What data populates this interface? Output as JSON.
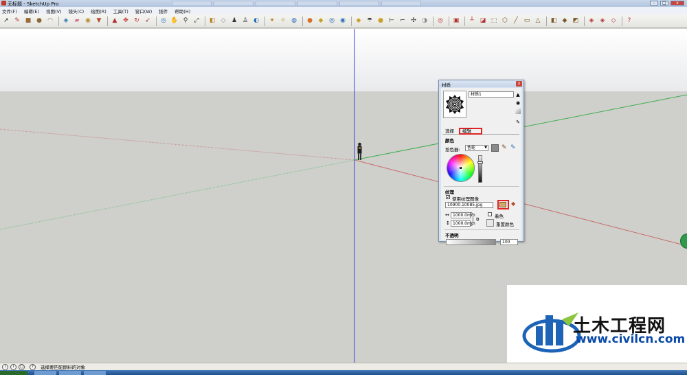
{
  "window": {
    "title": "无标题 - SketchUp Pro"
  },
  "menu": [
    "文件(F)",
    "编辑(E)",
    "视图(V)",
    "镜头(C)",
    "绘图(R)",
    "工具(T)",
    "窗口(W)",
    "插件",
    "帮助(H)"
  ],
  "toolbar_icons": [
    {
      "name": "select-icon",
      "glyph": "➚",
      "color": "#222"
    },
    {
      "name": "pencil-icon",
      "glyph": "✎",
      "color": "#b03030"
    },
    {
      "name": "rectangle-icon",
      "glyph": "■",
      "color": "#9b6b3c"
    },
    {
      "name": "circle-icon",
      "glyph": "●",
      "color": "#8a6a3a"
    },
    {
      "name": "arc-icon",
      "glyph": "◠",
      "color": "#8a6a3a"
    },
    {
      "name": "sep",
      "glyph": ""
    },
    {
      "name": "make-component-icon",
      "glyph": "◈",
      "color": "#2a6fb5"
    },
    {
      "name": "eraser-icon",
      "glyph": "▰",
      "color": "#d8708a"
    },
    {
      "name": "tape-measure-icon",
      "glyph": "◉",
      "color": "#b88a2a"
    },
    {
      "name": "paint-bucket-icon",
      "glyph": "▼",
      "color": "#b0502a"
    },
    {
      "name": "sep",
      "glyph": ""
    },
    {
      "name": "push-pull-icon",
      "glyph": "▲",
      "color": "#b03030"
    },
    {
      "name": "move-icon",
      "glyph": "✥",
      "color": "#c03030"
    },
    {
      "name": "rotate-icon",
      "glyph": "↻",
      "color": "#c03030"
    },
    {
      "name": "follow-me-icon",
      "glyph": "➶",
      "color": "#b03030"
    },
    {
      "name": "sep",
      "glyph": ""
    },
    {
      "name": "orbit-icon",
      "glyph": "◎",
      "color": "#2a6fb5"
    },
    {
      "name": "pan-icon",
      "glyph": "✋",
      "color": "#444"
    },
    {
      "name": "zoom-icon",
      "glyph": "⚲",
      "color": "#333"
    },
    {
      "name": "zoom-extents-icon",
      "glyph": "⤢",
      "color": "#333"
    },
    {
      "name": "sep",
      "glyph": ""
    },
    {
      "name": "previous-view-icon",
      "glyph": "◧",
      "color": "#b8872a"
    },
    {
      "name": "iso-view-icon",
      "glyph": "◇",
      "color": "#888"
    },
    {
      "name": "position-camera-icon",
      "glyph": "♟",
      "color": "#333"
    },
    {
      "name": "walk-icon",
      "glyph": "♙",
      "color": "#333"
    },
    {
      "name": "look-around-icon",
      "glyph": "◐",
      "color": "#2a6fb5"
    },
    {
      "name": "sep",
      "glyph": ""
    },
    {
      "name": "get-models-icon",
      "glyph": "✦",
      "color": "#b8872a"
    },
    {
      "name": "share-model-icon",
      "glyph": "✧",
      "color": "#b8872a"
    },
    {
      "name": "warehouse-icon",
      "glyph": "◍",
      "color": "#2a6fb5"
    },
    {
      "name": "sep",
      "glyph": ""
    },
    {
      "name": "google-earth-icon",
      "glyph": "●",
      "color": "#d8722a"
    },
    {
      "name": "photo-texture-icon",
      "glyph": "◆",
      "color": "#c8a02a"
    },
    {
      "name": "geo-location-icon",
      "glyph": "◎",
      "color": "#1a56a8"
    },
    {
      "name": "terrain-icon",
      "glyph": "◉",
      "color": "#2a6fb5"
    },
    {
      "name": "sep",
      "glyph": ""
    },
    {
      "name": "shadows-icon",
      "glyph": "◆",
      "color": "#c8a02a"
    },
    {
      "name": "fog-icon",
      "glyph": "☂",
      "color": "#333"
    },
    {
      "name": "section-plane-icon",
      "glyph": "●",
      "color": "#c8a02a"
    },
    {
      "name": "dimension-icon",
      "glyph": "⊢",
      "color": "#333"
    },
    {
      "name": "text-icon",
      "glyph": "⌐",
      "color": "#333"
    },
    {
      "name": "axes-icon",
      "glyph": "✣",
      "color": "#333"
    },
    {
      "name": "3d-text-icon",
      "glyph": "◑",
      "color": "#888"
    },
    {
      "name": "sep",
      "glyph": ""
    },
    {
      "name": "sandbox-icon",
      "glyph": "◎",
      "color": "#c03030"
    },
    {
      "name": "sep",
      "glyph": ""
    },
    {
      "name": "section-cut-icon",
      "glyph": "▣",
      "color": "#b03030"
    },
    {
      "name": "sep",
      "glyph": ""
    },
    {
      "name": "display-section-icon",
      "glyph": "┴",
      "color": "#c03030"
    },
    {
      "name": "section-fill-icon",
      "glyph": "◪",
      "color": "#b03030"
    },
    {
      "name": "xray-icon",
      "glyph": "⬚",
      "color": "#7a5a2a"
    },
    {
      "name": "wireframe-icon",
      "glyph": "⬡",
      "color": "#7a5a2a"
    },
    {
      "name": "hidden-line-icon",
      "glyph": "╱",
      "color": "#7a5a2a"
    },
    {
      "name": "shaded-icon",
      "glyph": "▭",
      "color": "#7a5a2a"
    },
    {
      "name": "shaded-texture-icon",
      "glyph": "△",
      "color": "#7a5a2a"
    },
    {
      "name": "sep",
      "glyph": ""
    },
    {
      "name": "monochrome-icon",
      "glyph": "◧",
      "color": "#7a5a2a"
    },
    {
      "name": "iso-box-icon",
      "glyph": "◆",
      "color": "#7a5a2a"
    },
    {
      "name": "top-view-icon",
      "glyph": "◩",
      "color": "#7a5a2a"
    },
    {
      "name": "sep",
      "glyph": ""
    },
    {
      "name": "front-view-icon",
      "glyph": "◈",
      "color": "#b03030"
    },
    {
      "name": "right-view-icon",
      "glyph": "◈",
      "color": "#b03030"
    },
    {
      "name": "back-view-icon",
      "glyph": "◇",
      "color": "#b03030"
    },
    {
      "name": "sep",
      "glyph": ""
    },
    {
      "name": "help-icon",
      "glyph": "?",
      "color": "#c03030"
    }
  ],
  "status": {
    "message": "选择要匹配颜料的对象"
  },
  "materials_panel": {
    "title": "材质",
    "material_name": "材质1",
    "tabs": {
      "select": "选择",
      "edit": "编辑"
    },
    "color_section": "颜色",
    "picker_label": "拾色器:",
    "picker_mode": "色轮",
    "texture_section": "纹理",
    "use_texture_label": "使用纹理图像",
    "use_texture_checked": "✓",
    "texture_file": "10900.10085.jpg",
    "width_value": "1000.0mm",
    "height_value": "1000.0mm",
    "colorize_label": "着色",
    "reset_color_label": "重置颜色",
    "opacity_section": "不透明",
    "opacity_value": "100",
    "close_glyph": "x"
  },
  "watermark": {
    "brand": "土木工程网",
    "url": "www.civilcn.com"
  },
  "colors": {
    "red_axis": "#c86a6a",
    "green_axis": "#3cae4c",
    "blue_axis": "#3a3ae0",
    "highlight": "#e02424"
  }
}
